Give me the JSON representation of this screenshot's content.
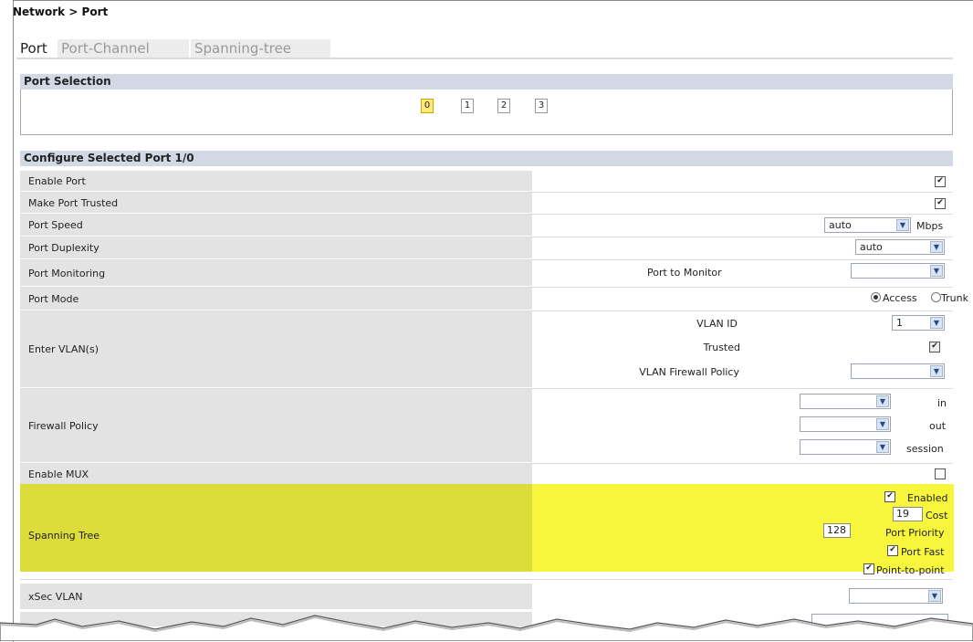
{
  "breadcrumb": "Network > Port",
  "tabs": [
    "Port",
    "Port-Channel",
    "Spanning-tree"
  ],
  "port_selection": {
    "title": "Port Selection",
    "ports": [
      "0",
      "1",
      "2",
      "3"
    ],
    "selected": "0"
  },
  "configure": {
    "title": "Configure Selected Port 1/0",
    "enable_port": {
      "label": "Enable Port",
      "checked": true
    },
    "make_port_trusted": {
      "label": "Make Port Trusted",
      "checked": true
    },
    "port_speed": {
      "label": "Port Speed",
      "value": "auto",
      "unit": "Mbps"
    },
    "port_duplexity": {
      "label": "Port Duplexity",
      "value": "auto"
    },
    "port_monitoring": {
      "label": "Port Monitoring",
      "sub_label": "Port to Monitor",
      "value": ""
    },
    "port_mode": {
      "label": "Port Mode",
      "options": [
        "Access",
        "Trunk"
      ],
      "selected": "Access"
    },
    "enter_vlans": {
      "label": "Enter VLAN(s)",
      "vlan_id_label": "VLAN ID",
      "vlan_id": "1",
      "trusted_label": "Trusted",
      "trusted_checked": true,
      "vlan_firewall_label": "VLAN Firewall Policy",
      "vlan_firewall_value": ""
    },
    "firewall_policy": {
      "label": "Firewall Policy",
      "in_label": "in",
      "out_label": "out",
      "session_label": "session"
    },
    "enable_mux": {
      "label": "Enable MUX",
      "checked": false
    },
    "spanning_tree": {
      "label": "Spanning Tree",
      "enabled_label": "Enabled",
      "enabled": true,
      "cost": "19",
      "cost_label": "Cost",
      "priority": "128",
      "priority_label": "Port Priority",
      "port_fast_label": "Port Fast",
      "port_fast": true,
      "p2p_label": "Point-to-point",
      "p2p": true
    },
    "xsec_vlan": {
      "label": "xSec VLAN",
      "value": ""
    }
  },
  "colors": {
    "highlight_left": "#dcdc3a",
    "highlight_right": "#f8f63c",
    "section_header": "#d2d9e5",
    "label_cell": "#e3e3e3",
    "selected_port": "#ffe97a"
  },
  "icons": {
    "dropdown": "chevron-down-icon",
    "checkbox": "checkmark-icon"
  }
}
